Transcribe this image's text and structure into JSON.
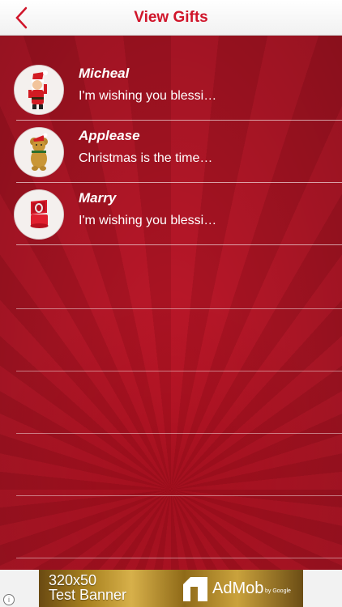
{
  "header": {
    "title": "View Gifts",
    "back_label": "<"
  },
  "gifts": [
    {
      "name": "Micheal",
      "message": "I'm wishing you blessi…",
      "icon": "santa-icon"
    },
    {
      "name": "Applease",
      "message": "Christmas is the time…",
      "icon": "teddy-bear-icon"
    },
    {
      "name": "Marry",
      "message": "I'm wishing you blessi…",
      "icon": "ring-box-icon"
    }
  ],
  "ad_banner": {
    "line1": "320x50",
    "line2": "Test Banner",
    "brand": "AdMob",
    "brand_sub": "by Google"
  },
  "colors": {
    "accent": "#d0152a",
    "background": "#b01424"
  }
}
